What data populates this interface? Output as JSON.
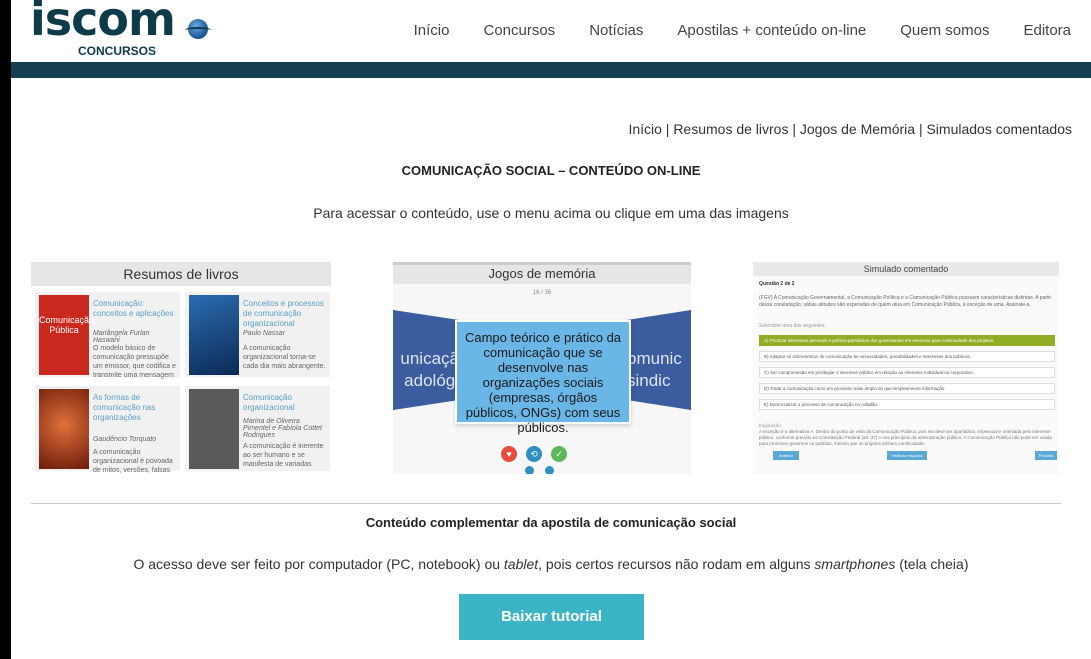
{
  "header": {
    "logo_word": "iscom",
    "logo_sub": "CONCURSOS",
    "nav": [
      "Início",
      "Concursos",
      "Notícias",
      "Apostilas + conteúdo on-line",
      "Quem somos",
      "Editora"
    ]
  },
  "breadcrumb": "Início | Resumos de livros | Jogos de Memória | Simulados comentados",
  "title": "COMUNICAÇÃO SOCIAL – CONTEÚDO ON-LINE",
  "subtitle": "Para acessar o conteúdo, use o menu acima ou clique em uma das imagens",
  "resumos": {
    "heading": "Resumos de livros",
    "books": [
      {
        "title": "Comunicação: conceitos e aplicações",
        "author": "Mariângela Furlan Haswani",
        "desc": "O modelo básico de comunicação pressupõe um emissor, que codifica e transmite uma mensagem",
        "cover_text": "Comunicação Pública",
        "cover_color": "#c8281e"
      },
      {
        "title": "Conceitos e processos de comunicação organizacional",
        "author": "Paulo Nassar",
        "desc": "A comunicação organizacional torna-se cada dia mais abrangente.",
        "cover_text": "",
        "cover_color": "#1d4f8a"
      },
      {
        "title": "As formas de comunicação nas organizações",
        "author": "Gaudêncio Torquato",
        "desc": "A comunicação organizacional é povoada de mitos, versões, falsas",
        "cover_text": "",
        "cover_color": "#b8391a"
      },
      {
        "title": "Comunicação organizacional",
        "author": "Marina de Oliveira Pimentel e Fabíola Cottet Rodrigues",
        "desc": "A comunicação é inerente ao ser humano e se manifesta de variadas",
        "cover_text": "",
        "cover_color": "#7a2a2a"
      }
    ]
  },
  "jogos": {
    "heading": "Jogos de memória",
    "counter": "16 / 36",
    "left_text": "unicaçã\nadológi",
    "right_text": "omunic\nsindic",
    "center_text": "Campo teórico e prático da comunicação que se desenvolve nas organizações sociais (empresas, órgãos públicos, ONGs) com seus públicos.",
    "icons": [
      "heart-icon",
      "repeat-icon",
      "thumbs-up-icon"
    ],
    "icon_colors": [
      "#e74c3c",
      "#2f8fc4",
      "#5cb85c"
    ]
  },
  "simulado": {
    "heading": "Simulado comentado",
    "question_label": "Questão 2 de 2",
    "question_text": "(FGV) A Comunicação Governamental, a Comunicação Política e a Comunicação Pública possuem características distintas. A partir dessa constatação, várias atitudes são esperadas de quem atua em Comunicação Pública, à exceção de uma. Assinale-a.",
    "select_label": "Selecione uma das seguintes:",
    "options": [
      "A) Priorizar interesses pessoais e político-partidários dos governantes em exercício para continuidade dos projetos.",
      "B) Adaptar os instrumentos de comunicação às necessidades, possibilidades e interesses dos públicos.",
      "C) Ser comprometida em privilegiar o interesse público em relação ao interesse individual ou corporativo.",
      "D) Tratar a comunicação como um processo mais amplo do que simplesmente informação.",
      "E) Democratizar o processo de comunicação no cidadão."
    ],
    "explanation_label": "Explicação",
    "explanation": "A exceção é a alternativa A. Dentro do ponto de vista da Comunicação Pública, pois ela deve ser apartidária, impessoal e orientada pelo interesse público, conforme previsto na Constituição Federal (art. 37) e nos princípios da administração pública. A Comunicação Pública não pode ser usada para promover governos ou partidos, mesmo que os projetos tenham continuidade.",
    "buttons": [
      "Anterior",
      "Verificar resposta",
      "Próxima"
    ]
  },
  "complementar": "Conteúdo complementar da apostila de comunicação social",
  "note": {
    "part1": "O acesso deve ser feito por computador (PC, notebook) ou ",
    "italic1": "tablet",
    "part2": ", pois certos recursos não rodam em alguns ",
    "italic2": "smartphones",
    "part3": " (tela cheia)"
  },
  "download_button": "Baixar tutorial"
}
